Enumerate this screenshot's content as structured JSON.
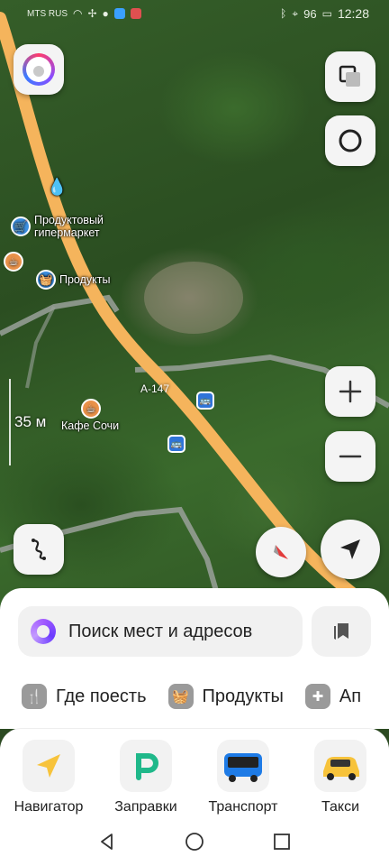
{
  "status_bar": {
    "carrier": "MTS RUS",
    "battery": "96",
    "time": "12:28"
  },
  "map": {
    "pois": [
      {
        "name": "Продуктовый гипермаркет",
        "line1": "Продуктовый",
        "line2": "гипермаркет",
        "icon": "shopping-cart-icon",
        "color": "#3d8fe0"
      },
      {
        "name": "Продукты",
        "icon": "basket-icon",
        "color": "#3d8fe0"
      },
      {
        "name": "Кафе Сочи",
        "icon": "coffee-cup-icon",
        "color": "#e9924a"
      }
    ],
    "road_label": "А-147",
    "scale_label": "35 м",
    "road_color": "#f5b45c"
  },
  "search": {
    "placeholder": "Поиск мест и адресов"
  },
  "categories": [
    {
      "label": "Где поесть",
      "icon": "fork-knife-icon"
    },
    {
      "label": "Продукты",
      "icon": "basket-icon"
    },
    {
      "label": "Ап",
      "icon": "plus-icon"
    }
  ],
  "dock": [
    {
      "label": "Навигатор",
      "icon": "navigator-arrow-icon"
    },
    {
      "label": "Заправки",
      "icon": "fuel-p-icon"
    },
    {
      "label": "Транспорт",
      "icon": "bus-icon"
    },
    {
      "label": "Такси",
      "icon": "taxi-car-icon"
    }
  ],
  "colors": {
    "accent": "#3d8fe0",
    "cafe": "#e9924a",
    "alice": "#8a4dff"
  }
}
